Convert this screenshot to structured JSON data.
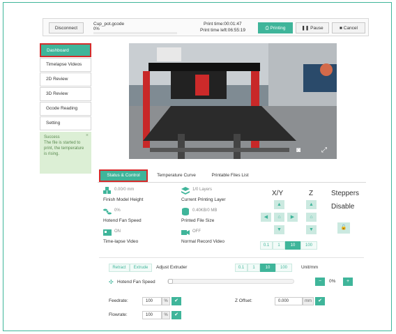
{
  "header": {
    "disconnect_label": "Disconnect",
    "filename": "Cup_pot.gcode",
    "percent": "0%",
    "progress": 0,
    "print_time": "Print time:00:01:47",
    "finish_time": "Print time left:06:55:19",
    "printing_label": "Printing",
    "pause_label": "Pause",
    "cancel_label": "Cancel"
  },
  "sidebar": {
    "items": [
      {
        "label": "Dashboard"
      },
      {
        "label": "Timelapse Videos"
      },
      {
        "label": "2D Review"
      },
      {
        "label": "3D Review"
      },
      {
        "label": "Gcode Reading"
      },
      {
        "label": "Setting"
      }
    ],
    "alert_title": "Success",
    "alert_text": "The file is started to print, the temperature is rising."
  },
  "tabs": [
    {
      "label": "Status & Control"
    },
    {
      "label": "Temperature Curve"
    },
    {
      "label": "Printable Files List"
    }
  ],
  "status": {
    "model_height_value": "0.00/0 mm",
    "model_height_label": "Finish Model Height",
    "layers_value": "1/0 Layers",
    "layers_label": "Current Printing Layer",
    "hotend_fan_value": "0%",
    "hotend_fan_label": "Hotend Fan Speed",
    "file_size_value": "0.40KB/0 MB",
    "file_size_label": "Printed File Size",
    "timelapse_value": "ON",
    "timelapse_label": "Time-lapse Video",
    "normal_video_value": "OFF",
    "normal_video_label": "Normal Record Video"
  },
  "controls": {
    "xy_label": "X/Y",
    "z_label": "Z",
    "steppers_label": "Steppers",
    "disable_label": "Disable",
    "steps": [
      "0.1",
      "1",
      "10",
      "100"
    ]
  },
  "extruder": {
    "retract_label": "Retract",
    "extrude_label": "Extrude",
    "adjust_label": "Adjust Extruder",
    "steps": [
      "0.1",
      "1",
      "10",
      "100"
    ],
    "unit_label": "Unit/mm",
    "fan_label": "Hotend Fan Speed",
    "fan_value": "0%",
    "feedrate_label": "Feedrate:",
    "feedrate_value": "100",
    "flowrate_label": "Flowrate:",
    "flowrate_value": "100",
    "percent_unit": "%",
    "zoffset_label": "Z Offset:",
    "zoffset_value": "0.000",
    "mm_unit": "mm"
  },
  "colors": {
    "accent": "#3fb59a",
    "highlight": "#d62b2b",
    "alert_bg": "#dcefd5"
  }
}
